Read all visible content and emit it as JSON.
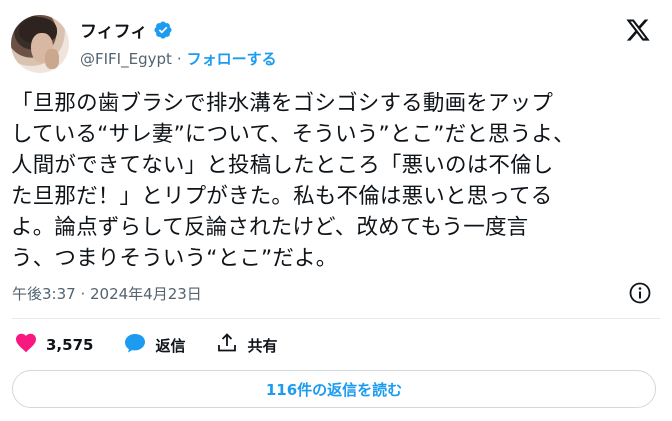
{
  "author": {
    "display_name": "フィフィ",
    "handle": "@FIFI_Egypt",
    "separator": "·",
    "follow_label": "フォローする"
  },
  "tweet": {
    "lines": [
      "「旦那の歯ブラシで排水溝をゴシゴシする動画をアップ",
      "している“サレ妻”について、そういう”とこ”だと思うよ、",
      "人間ができてない」と投稿したところ「悪いのは不倫し",
      "た旦那だ！」とリプがきた。私も不倫は悪いと思ってる",
      "よ。論点ずらして反論されたけど、改めてもう一度言",
      "う、つまりそういう“とこ”だよ。"
    ],
    "timestamp": "午後3:37 · 2024年4月23日"
  },
  "actions": {
    "like_count": "3,575",
    "reply_label": "返信",
    "share_label": "共有"
  },
  "replies_button": "116件の返信を読む",
  "colors": {
    "accent": "#1d9bf0",
    "like": "#f91880",
    "muted": "#536471"
  },
  "icons": [
    "x-logo-icon",
    "verified-badge-icon",
    "info-icon",
    "heart-icon",
    "reply-icon",
    "share-icon"
  ]
}
